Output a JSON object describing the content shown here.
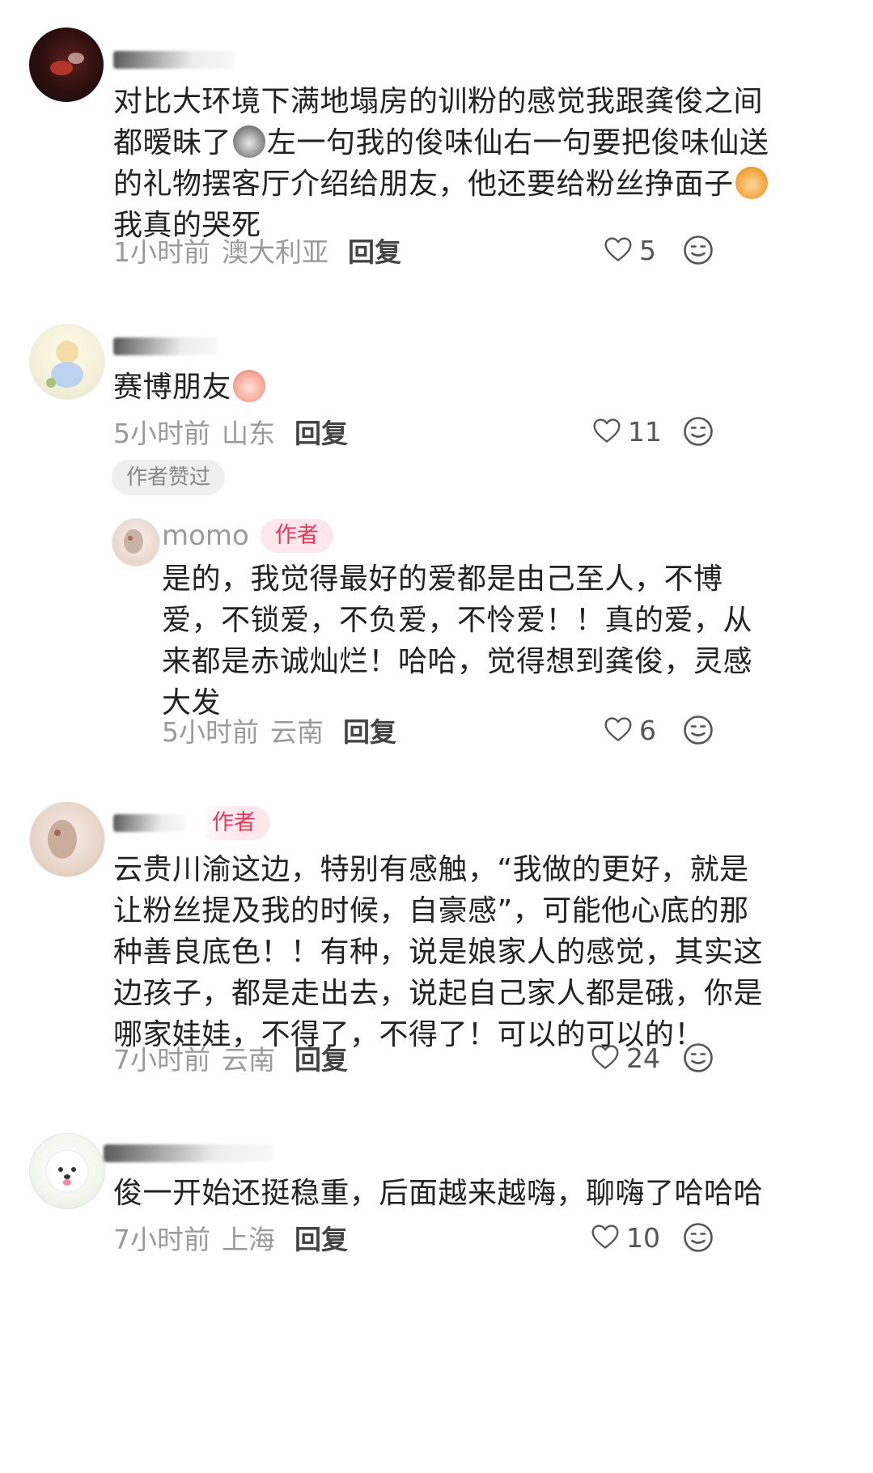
{
  "comments": [
    {
      "text_lines": [
        "对比大环境下满地塌房的训粉的感觉我跟龚俊之间",
        "都暧昧了",
        "左一句我的俊味仙右一句要把俊味仙送",
        "的礼物摆客厅介绍给朋友，他还要给粉丝挣面子",
        "我真的哭死"
      ],
      "time": "1小时前",
      "region": "澳大利亚",
      "reply_label": "回复",
      "likes": "5"
    },
    {
      "text": "赛博朋友",
      "time": "5小时前",
      "region": "山东",
      "reply_label": "回复",
      "likes": "11",
      "liked_badge": "作者赞过",
      "reply": {
        "username": "momo",
        "badge": "作者",
        "text_lines": [
          "是的，我觉得最好的爱都是由己至人，不博",
          "爱，不锁爱，不负爱，不怜爱！！真的爱，从",
          "来都是赤诚灿烂！哈哈，觉得想到龚俊，灵感",
          "大发"
        ],
        "time": "5小时前",
        "region": "云南",
        "reply_label": "回复",
        "likes": "6"
      }
    },
    {
      "badge": "作者",
      "text_lines": [
        "云贵川渝这边，特别有感触，“我做的更好，就是",
        "让粉丝提及我的时候，自豪感”，可能他心底的那",
        "种善良底色！！有种，说是娘家人的感觉，其实这",
        "边孩子，都是走出去，说起自己家人都是硪，你是",
        "哪家娃娃，不得了，不得了！可以的可以的！"
      ],
      "time": "7小时前",
      "region": "云南",
      "reply_label": "回复",
      "likes": "24"
    },
    {
      "text": "俊一开始还挺稳重，后面越来越嗨，聊嗨了哈哈哈",
      "time": "7小时前",
      "region": "上海",
      "reply_label": "回复",
      "likes": "10"
    }
  ],
  "colors": {
    "like_outline": "#555555",
    "author_badge_text": "#e5395a",
    "author_badge_bg": "#fde7ea",
    "meta_gray": "#9a9a9a"
  },
  "icons": [
    "heart-outline-icon",
    "emoji-reaction-icon"
  ]
}
